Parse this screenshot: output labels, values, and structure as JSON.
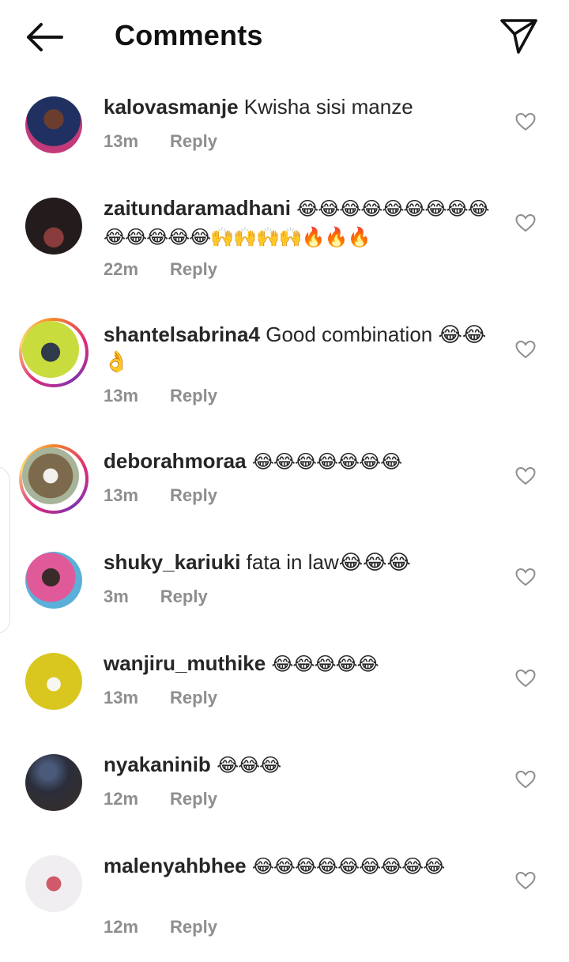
{
  "header": {
    "title": "Comments",
    "back_icon": "arrow-left-icon",
    "send_icon": "paper-plane-icon"
  },
  "reply_label": "Reply",
  "comments": [
    {
      "username": "kalovasmanje",
      "text": "Kwisha sisi manze",
      "time": "13m",
      "avatar_color": "#1f2d5a"
    },
    {
      "username": "zaitundaramadhani",
      "text": "😂😂😂😂😂😂😂😂😂😂😂😂😂😂🙌🙌🙌🙌🔥🔥🔥",
      "time": "22m",
      "avatar_color": "#3a2a2a"
    },
    {
      "username": "shantelsabrina4",
      "text": "Good combination 😂😂👌",
      "time": "13m",
      "avatar_color": "#c6d84a"
    },
    {
      "username": "deborahmoraa",
      "text": "😂😂😂😂😂😂😂",
      "time": "13m",
      "avatar_color": "#8c7a5e"
    },
    {
      "username": "shuky_kariuki",
      "text": "fata in law😂😂😂",
      "time": "3m",
      "avatar_color": "#d94f8e"
    },
    {
      "username": "wanjiru_muthike",
      "text": "😂😂😂😂😂",
      "time": "13m",
      "avatar_color": "#d8c92a"
    },
    {
      "username": "nyakaninib",
      "text": "😂😂😂",
      "time": "12m",
      "avatar_color": "#2e3140"
    },
    {
      "username": "malenyahbhee",
      "text": "😂😂😂😂😂😂😂😂😂",
      "time": "12m",
      "avatar_color": "#e7e3e6"
    }
  ]
}
